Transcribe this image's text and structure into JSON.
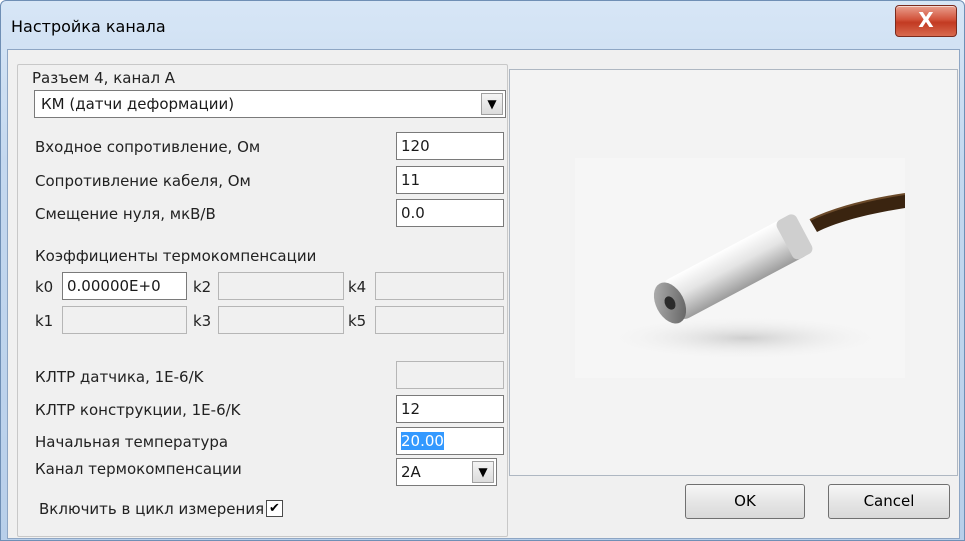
{
  "window": {
    "title": "Настройка канала",
    "close_label": "X"
  },
  "group": {
    "legend": "Разъем 4, канал А",
    "sensor_type": "КМ (датчи деформации)"
  },
  "params": {
    "input_resistance_label": "Входное сопротивление, Ом",
    "input_resistance_value": "120",
    "cable_resistance_label": "Сопротивление кабеля, Ом",
    "cable_resistance_value": "11",
    "zero_offset_label": "Смещение нуля, мкВ/В",
    "zero_offset_value": "0.0"
  },
  "thermo": {
    "heading": "Коэффициенты термокомпенсации",
    "k0_label": "k0",
    "k0_value": "0.00000E+0",
    "k1_label": "k1",
    "k2_label": "k2",
    "k3_label": "k3",
    "k4_label": "k4",
    "k5_label": "k5"
  },
  "expansion": {
    "sensor_ktr_label": "КЛТР датчика, 1E-6/K",
    "sensor_ktr_value": "",
    "structure_ktr_label": "КЛТР конструкции, 1E-6/K",
    "structure_ktr_value": "12",
    "start_temp_label": "Начальная температура",
    "start_temp_value": "20.00",
    "comp_channel_label": "Канал термокомпенсации",
    "comp_channel_value": "2А"
  },
  "measure": {
    "include_label": "Включить в цикл измерения",
    "include_checked": true,
    "check_mark": "✔"
  },
  "buttons": {
    "ok": "OK",
    "cancel": "Cancel"
  },
  "icons": {
    "dropdown": "▼"
  }
}
